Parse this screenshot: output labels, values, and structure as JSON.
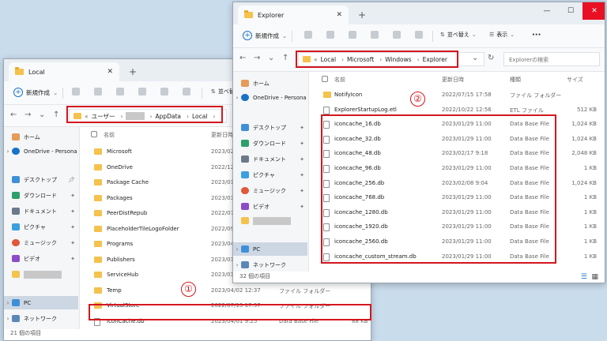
{
  "left_window": {
    "tab_title": "Local",
    "new_label": "新規作成",
    "view_label": "並べ替",
    "address": [
      "ユーザー",
      "AppData",
      "Local"
    ],
    "columns": [
      "名前",
      "更新日時"
    ],
    "sidebar": [
      {
        "label": "ホーム",
        "icon": "home-icon"
      },
      {
        "label": "OneDrive - Persona",
        "icon": "onedrive-icon"
      },
      {
        "label": "デスクトップ",
        "icon": "desktop-icon"
      },
      {
        "label": "ダウンロード",
        "icon": "download-icon"
      },
      {
        "label": "ドキュメント",
        "icon": "documents-icon"
      },
      {
        "label": "ピクチャ",
        "icon": "pictures-icon"
      },
      {
        "label": "ミュージック",
        "icon": "music-icon"
      },
      {
        "label": "ビデオ",
        "icon": "video-icon"
      },
      {
        "label": "PC",
        "icon": "pc-icon"
      },
      {
        "label": "ネットワーク",
        "icon": "network-icon"
      }
    ],
    "files": [
      {
        "name": "Microsoft",
        "date": "2023/02/",
        "type": "",
        "size": ""
      },
      {
        "name": "OneDrive",
        "date": "2022/12/",
        "type": "",
        "size": ""
      },
      {
        "name": "Package Cache",
        "date": "2023/01/",
        "type": "",
        "size": ""
      },
      {
        "name": "Packages",
        "date": "2023/03/",
        "type": "",
        "size": ""
      },
      {
        "name": "PeerDistRepub",
        "date": "2022/07/",
        "type": "",
        "size": ""
      },
      {
        "name": "PlaceholderTileLogoFolder",
        "date": "2022/09/",
        "type": "",
        "size": ""
      },
      {
        "name": "Programs",
        "date": "2023/04/",
        "type": "",
        "size": ""
      },
      {
        "name": "Publishers",
        "date": "2023/01/",
        "type": "",
        "size": ""
      },
      {
        "name": "ServiceHub",
        "date": "2023/01/",
        "type": "",
        "size": ""
      },
      {
        "name": "Temp",
        "date": "2023/04/02 12:37",
        "type": "ファイル フォルダー",
        "size": ""
      },
      {
        "name": "VirtualStore",
        "date": "2022/07/15 17:57",
        "type": "ファイル フォルダー",
        "size": ""
      },
      {
        "name": "IconCache.db",
        "date": "2023/04/01 9:25",
        "type": "Data Base File",
        "size": "88 KB"
      }
    ],
    "status": "21 個の項目"
  },
  "right_window": {
    "tab_title": "Explorer",
    "new_label": "新規作成",
    "sort_label": "並べ替え",
    "view_label": "表示",
    "more_label": "···",
    "address": [
      "Local",
      "Microsoft",
      "Windows",
      "Explorer"
    ],
    "search_placeholder": "Explorerの検索",
    "columns": [
      "名前",
      "更新日時",
      "種類",
      "サイズ"
    ],
    "sidebar": [
      {
        "label": "ホーム",
        "icon": "home-icon"
      },
      {
        "label": "OneDrive - Persona",
        "icon": "onedrive-icon"
      },
      {
        "label": "デスクトップ",
        "icon": "desktop-icon"
      },
      {
        "label": "ダウンロード",
        "icon": "download-icon"
      },
      {
        "label": "ドキュメント",
        "icon": "documents-icon"
      },
      {
        "label": "ピクチャ",
        "icon": "pictures-icon"
      },
      {
        "label": "ミュージック",
        "icon": "music-icon"
      },
      {
        "label": "ビデオ",
        "icon": "video-icon"
      },
      {
        "label": "PC",
        "icon": "pc-icon"
      },
      {
        "label": "ネットワーク",
        "icon": "network-icon"
      }
    ],
    "files": [
      {
        "name": "NotifyIcon",
        "date": "2022/07/15 17:58",
        "type": "ファイル フォルダー",
        "size": "",
        "kind": "folder"
      },
      {
        "name": "ExplorerStartupLog.etl",
        "date": "2022/10/22 12:56",
        "type": "ETL ファイル",
        "size": "512 KB",
        "kind": "file"
      },
      {
        "name": "iconcache_16.db",
        "date": "2023/01/29 11:00",
        "type": "Data Base File",
        "size": "1,024 KB",
        "kind": "file"
      },
      {
        "name": "iconcache_32.db",
        "date": "2023/01/29 11:00",
        "type": "Data Base File",
        "size": "1,024 KB",
        "kind": "file"
      },
      {
        "name": "iconcache_48.db",
        "date": "2023/02/17 9:18",
        "type": "Data Base File",
        "size": "2,048 KB",
        "kind": "file"
      },
      {
        "name": "iconcache_96.db",
        "date": "2023/01/29 11:00",
        "type": "Data Base File",
        "size": "1 KB",
        "kind": "file"
      },
      {
        "name": "iconcache_256.db",
        "date": "2023/02/08 9:04",
        "type": "Data Base File",
        "size": "1,024 KB",
        "kind": "file"
      },
      {
        "name": "iconcache_768.db",
        "date": "2023/01/29 11:00",
        "type": "Data Base File",
        "size": "1 KB",
        "kind": "file"
      },
      {
        "name": "iconcache_1280.db",
        "date": "2023/01/29 11:00",
        "type": "Data Base File",
        "size": "1 KB",
        "kind": "file"
      },
      {
        "name": "iconcache_1920.db",
        "date": "2023/01/29 11:00",
        "type": "Data Base File",
        "size": "1 KB",
        "kind": "file"
      },
      {
        "name": "iconcache_2560.db",
        "date": "2023/01/29 11:00",
        "type": "Data Base File",
        "size": "1 KB",
        "kind": "file"
      },
      {
        "name": "iconcache_custom_stream.db",
        "date": "2023/01/29 11:00",
        "type": "Data Base File",
        "size": "1 KB",
        "kind": "file"
      }
    ],
    "status": "32 個の項目"
  },
  "annotations": {
    "one": "①",
    "two": "②"
  },
  "colors": {
    "highlight": "#d4161e",
    "folder": "#f4c24d",
    "close": "#e81123"
  }
}
